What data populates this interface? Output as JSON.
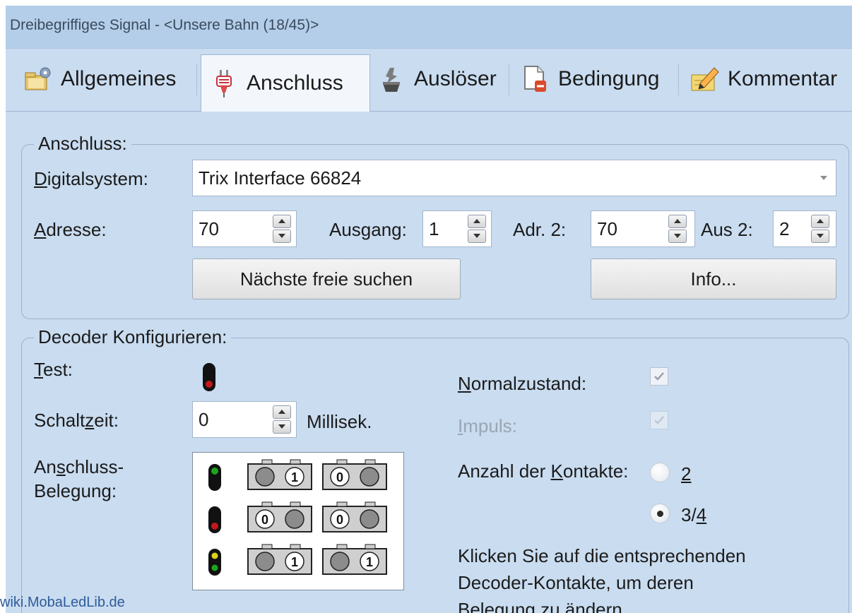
{
  "window": {
    "title": "Dreibegriffiges Signal - <Unsere Bahn (18/45)>"
  },
  "tabs": [
    {
      "label": "Allgemeines",
      "icon": "settings-folder-icon"
    },
    {
      "label": "Anschluss",
      "icon": "plug-icon",
      "active": true
    },
    {
      "label": "Auslöser",
      "icon": "trigger-icon"
    },
    {
      "label": "Bedingung",
      "icon": "condition-document-icon"
    },
    {
      "label": "Kommentar",
      "icon": "comment-pencil-icon"
    }
  ],
  "anschluss": {
    "legend": "Anschluss:",
    "digitalsystem_label": "Digitalsystem:",
    "digitalsystem_value": "Trix Interface 66824",
    "adresse_label": "Adresse:",
    "adresse_value": "70",
    "ausgang_label": "Ausgang:",
    "ausgang_value": "1",
    "adr2_label": "Adr. 2:",
    "adr2_value": "70",
    "aus2_label": "Aus 2:",
    "aus2_value": "2",
    "search_button": "Nächste freie suchen",
    "info_button": "Info..."
  },
  "decoder": {
    "legend": "Decoder Konfigurieren:",
    "test_label": "Test:",
    "schaltzeit_label": "Schaltzeit:",
    "schaltzeit_value": "0",
    "schaltzeit_unit": "Millisek.",
    "belegung_label_1": "Anschluss-",
    "belegung_label_2": "Belegung:",
    "normalzustand_label": "Normalzustand:",
    "normalzustand_checked": true,
    "impuls_label": "Impuls:",
    "impuls_checked": true,
    "kontakte_label": "Anzahl der Kontakte:",
    "kontakte_options": [
      "2",
      "3/4"
    ],
    "kontakte_selected": "3/4",
    "help_line_1": "Klicken Sie auf die entsprechenden",
    "help_line_2": "Decoder-Kontakte, um deren",
    "help_line_3": "Belegung zu ändern.",
    "belegung_rows": [
      {
        "signal": "green",
        "contacts": [
          [
            "",
            "1"
          ],
          [
            "0",
            ""
          ]
        ]
      },
      {
        "signal": "red",
        "contacts": [
          [
            "0",
            ""
          ],
          [
            "0",
            ""
          ]
        ]
      },
      {
        "signal": "yellow-green",
        "contacts": [
          [
            "",
            "1"
          ],
          [
            "",
            "1"
          ]
        ]
      }
    ]
  },
  "colors": {
    "window_bg": "#c9dcf0",
    "titlebar_bg": "#b4cee9",
    "signal_red": "#c2181c",
    "signal_green": "#1ea51e",
    "signal_yellow": "#e0d21a"
  },
  "watermark": "wiki.MobaLedLib.de"
}
